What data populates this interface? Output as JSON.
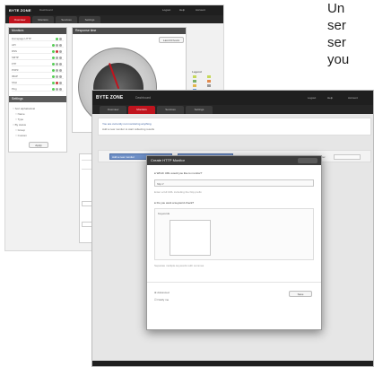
{
  "back_screenshot": {
    "logo": "BYTE ZONE",
    "logo_sub": "Dashboard",
    "top_links": [
      "Logout",
      "Help",
      "Account"
    ],
    "nav_tabs": [
      "Overview",
      "Monitors",
      "Services",
      "Settings"
    ],
    "left_panel_title": "Monitors",
    "left_rows": [
      "Homepage HTTP",
      "API",
      "DNS",
      "SMTP",
      "FTP",
      "POP3",
      "IMAP",
      "SSH",
      "Ping"
    ],
    "left_sub_title": "Settings",
    "left_sub_items": [
      "Sort alphabetical",
      "Name",
      "Type",
      "By status",
      "Group",
      "Custom"
    ],
    "left_button": "Apply",
    "main_panel_title": "Response time",
    "main_top_button": "Last 24 hours",
    "gauge_label_top": "Response",
    "gauge_label_value": "1260",
    "gauge_label_bottom": "ms",
    "legend_title": "Legend"
  },
  "front_screenshot": {
    "logo": "BYTE ZONE",
    "logo_sub": "Dashboard",
    "top_links": [
      "Logout",
      "Help",
      "Account"
    ],
    "nav_tabs": [
      "Overview",
      "Monitors",
      "Services",
      "Settings"
    ],
    "notice_line1": "You are currently not monitoring anything",
    "notice_line2": "Add a new monitor to start collecting results",
    "toolbar_btn1": "Add a new monitor",
    "toolbar_btn2": "Create new service",
    "toolbar_right": "Filter",
    "dialog": {
      "title": "Create HTTP Monitor",
      "q1": "Which URL would you like to monitor?",
      "url_value": "http://",
      "q1_hint": "Enter a full URL including the http prefix",
      "q2": "Do you want a keyword check?",
      "q2_label": "Keywords",
      "q2_hint": "Separate multiple keywords with commas",
      "advanced_label": "Advanced",
      "checkbox_label": "Notify me",
      "save_button": "Save"
    }
  },
  "side_text_lines": [
    "Un",
    "ser",
    "ser",
    "you"
  ],
  "colors": {
    "brand_red": "#c0141e",
    "topbar": "#1f1f1f",
    "button_blue": "#6e8fc6"
  }
}
